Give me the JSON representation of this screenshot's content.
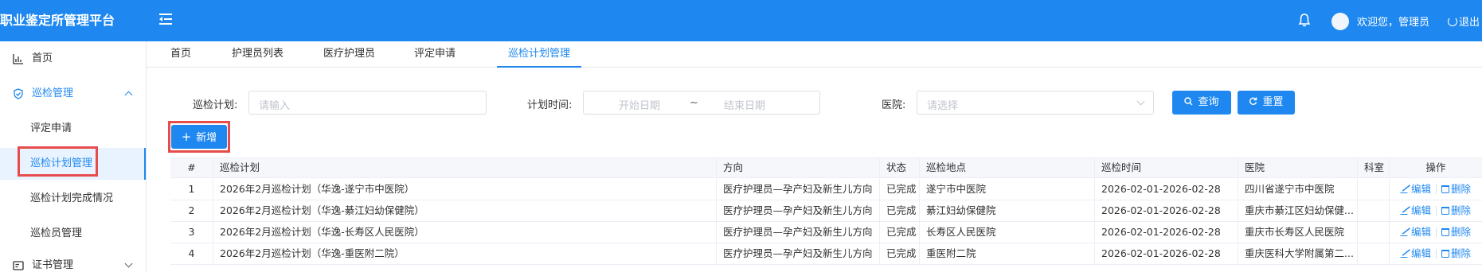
{
  "header": {
    "app_title": "职业鉴定所管理平台",
    "welcome": "欢迎您，管理员",
    "logout": "退出"
  },
  "sidebar": {
    "items": [
      {
        "label": "首页"
      },
      {
        "label": "巡检管理"
      },
      {
        "label": "评定申请"
      },
      {
        "label": "巡检计划管理"
      },
      {
        "label": "巡检计划完成情况"
      },
      {
        "label": "巡检员管理"
      },
      {
        "label": "证书管理"
      }
    ]
  },
  "tabs": [
    {
      "label": "首页"
    },
    {
      "label": "护理员列表"
    },
    {
      "label": "医疗护理员"
    },
    {
      "label": "评定申请"
    },
    {
      "label": "巡检计划管理"
    }
  ],
  "search": {
    "plan_label": "巡检计划:",
    "plan_placeholder": "请输入",
    "time_label": "计划时间:",
    "start_placeholder": "开始日期",
    "range_sep": "~",
    "end_placeholder": "结束日期",
    "hospital_label": "医院:",
    "hospital_placeholder": "请选择",
    "query_label": "查询",
    "reset_label": "重置"
  },
  "toolbar": {
    "add_label": "新增"
  },
  "table": {
    "columns": [
      "#",
      "巡检计划",
      "方向",
      "状态",
      "巡检地点",
      "巡检时间",
      "医院",
      "科室",
      "操作"
    ],
    "edit_label": "编辑",
    "delete_label": "删除",
    "rows": [
      {
        "no": "1",
        "plan": "2026年2月巡检计划（华逸-遂宁市中医院）",
        "direction": "医疗护理员—孕产妇及新生儿方向",
        "status": "已完成",
        "location": "遂宁市中医院",
        "time": "2026-02-01-2026-02-28",
        "hospital": "四川省遂宁市中医院",
        "dept": ""
      },
      {
        "no": "2",
        "plan": "2026年2月巡检计划（华逸-綦江妇幼保健院）",
        "direction": "医疗护理员—孕产妇及新生儿方向",
        "status": "已完成",
        "location": "綦江妇幼保健院",
        "time": "2026-02-01-2026-02-28",
        "hospital": "重庆市綦江区妇幼保健...",
        "dept": ""
      },
      {
        "no": "3",
        "plan": "2026年2月巡检计划（华逸-长寿区人民医院）",
        "direction": "医疗护理员—孕产妇及新生儿方向",
        "status": "已完成",
        "location": "长寿区人民医院",
        "time": "2026-02-01-2026-02-28",
        "hospital": "重庆市长寿区人民医院",
        "dept": ""
      },
      {
        "no": "4",
        "plan": "2026年2月巡检计划（华逸-重医附二院）",
        "direction": "医疗护理员—孕产妇及新生儿方向",
        "status": "已完成",
        "location": "重医附二院",
        "time": "2026-02-01-2026-02-28",
        "hospital": "重庆医科大学附属第二...",
        "dept": ""
      }
    ]
  },
  "colors": {
    "primary": "#1e88f0",
    "highlight": "#e74c4c"
  },
  "icons": {
    "menu_toggle": "menu-fold-icon",
    "bell": "bell-icon",
    "logout": "logout-icon",
    "home": "chart-icon",
    "inspection": "shield-icon",
    "certificate": "certificate-icon",
    "search": "search-icon",
    "reset": "refresh-icon",
    "add": "plus-icon",
    "edit": "edit-icon",
    "delete": "delete-icon"
  }
}
